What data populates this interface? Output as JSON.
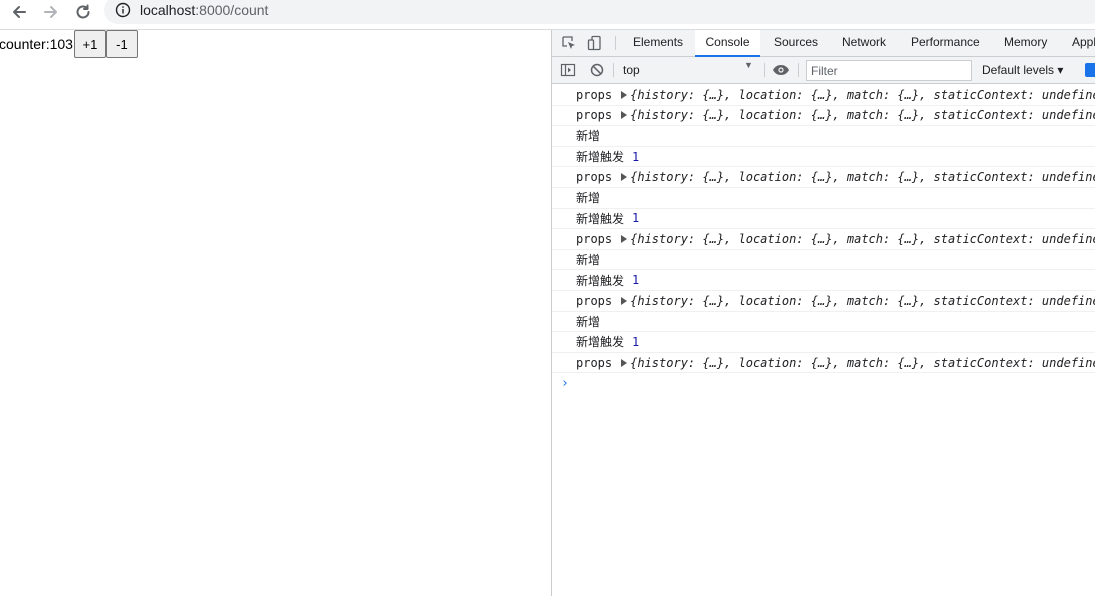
{
  "browser": {
    "url_host": "localhost",
    "url_rest": ":8000/count",
    "icons": [
      "back-arrow-icon",
      "forward-arrow-icon",
      "reload-icon",
      "info-icon"
    ]
  },
  "page": {
    "counter_label": "counter:103",
    "increment_label": "+1",
    "decrement_label": "-1"
  },
  "devtools": {
    "tabs": [
      "Elements",
      "Console",
      "Sources",
      "Network",
      "Performance",
      "Memory",
      "Appl"
    ],
    "active_tab": "Console",
    "context": "top",
    "filter_placeholder": "Filter",
    "levels_label": "Default levels ▾",
    "accent_color": "#1a73e8",
    "logs": [
      {
        "kind": "props",
        "label": "props",
        "object": "{history: {…}, location: {…}, match: {…}, staticContext: undefined"
      },
      {
        "kind": "props",
        "label": "props",
        "object": "{history: {…}, location: {…}, match: {…}, staticContext: undefined"
      },
      {
        "kind": "text",
        "label": "新增"
      },
      {
        "kind": "num",
        "label": "新增触发",
        "value": "1"
      },
      {
        "kind": "props",
        "label": "props",
        "object": "{history: {…}, location: {…}, match: {…}, staticContext: undefined"
      },
      {
        "kind": "text",
        "label": "新增"
      },
      {
        "kind": "num",
        "label": "新增触发",
        "value": "1"
      },
      {
        "kind": "props",
        "label": "props",
        "object": "{history: {…}, location: {…}, match: {…}, staticContext: undefined"
      },
      {
        "kind": "text",
        "label": "新增"
      },
      {
        "kind": "num",
        "label": "新增触发",
        "value": "1"
      },
      {
        "kind": "props",
        "label": "props",
        "object": "{history: {…}, location: {…}, match: {…}, staticContext: undefined"
      },
      {
        "kind": "text",
        "label": "新增"
      },
      {
        "kind": "num",
        "label": "新增触发",
        "value": "1"
      },
      {
        "kind": "props",
        "label": "props",
        "object": "{history: {…}, location: {…}, match: {…}, staticContext: undefined"
      }
    ]
  }
}
